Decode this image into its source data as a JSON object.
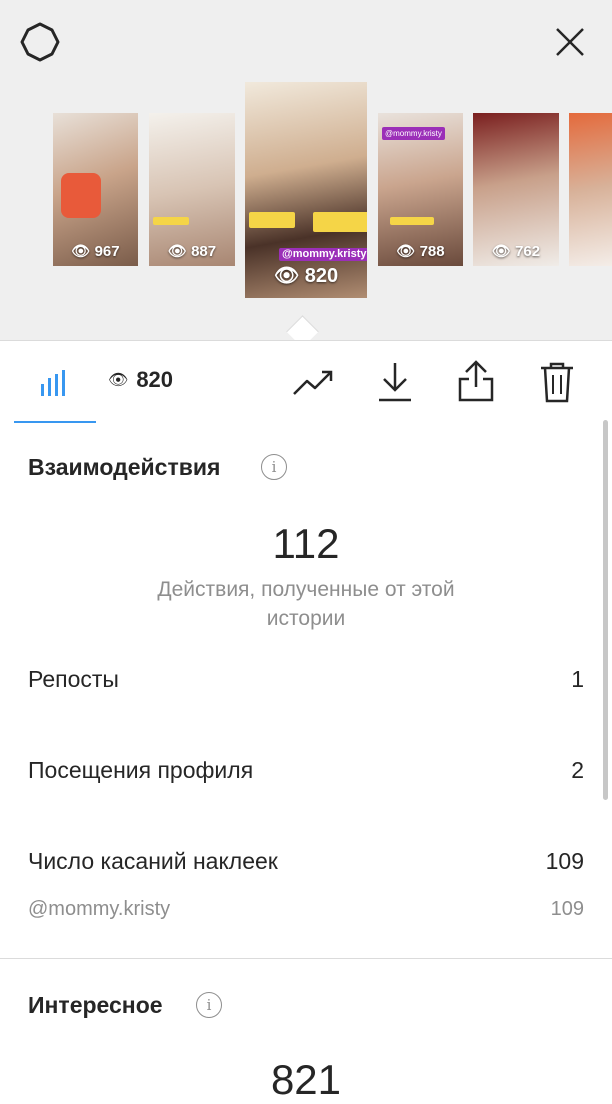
{
  "stories": [
    {
      "views": "967"
    },
    {
      "views": "887"
    },
    {
      "views": "820",
      "tag": "@mommy.kristy"
    },
    {
      "views": "788",
      "tag": "@mommy.kristy"
    },
    {
      "views": "762"
    }
  ],
  "tabs": {
    "views": "820"
  },
  "interactions": {
    "title": "Взаимодействия",
    "total": "112",
    "caption": "Действия, полученные от этой истории",
    "rows": [
      {
        "label": "Репосты",
        "value": "1"
      },
      {
        "label": "Посещения профиля",
        "value": "2"
      },
      {
        "label": "Число касаний наклеек",
        "value": "109"
      }
    ],
    "sub": {
      "label": "@mommy.kristy",
      "value": "109"
    }
  },
  "discovery": {
    "title": "Интересное",
    "total": "821"
  },
  "colors": {
    "accent": "#3897f0",
    "tag_purple": "#9b2fb8",
    "tag_yellow": "#f5d547"
  }
}
